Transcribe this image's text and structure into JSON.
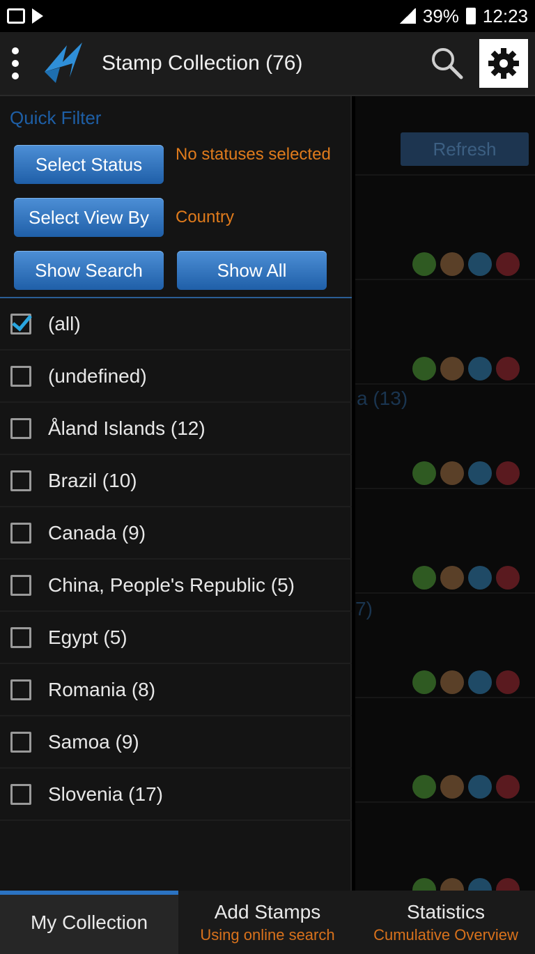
{
  "status_bar": {
    "battery": "39%",
    "time": "12:23"
  },
  "app_bar": {
    "title": "Stamp Collection (76)"
  },
  "background": {
    "refresh_label": "Refresh",
    "ghost_1": "a (13)",
    "ghost_2": "7)"
  },
  "drawer": {
    "quick_filter_title": "Quick Filter",
    "select_status_label": "Select Status",
    "status_note": "No statuses selected",
    "select_view_label": "Select View By",
    "view_note": "Country",
    "show_search_label": "Show Search",
    "show_all_label": "Show All",
    "items": [
      {
        "label": "(all)",
        "checked": true
      },
      {
        "label": "(undefined)",
        "checked": false
      },
      {
        "label": "Åland Islands (12)",
        "checked": false
      },
      {
        "label": "Brazil (10)",
        "checked": false
      },
      {
        "label": "Canada (9)",
        "checked": false
      },
      {
        "label": "China, People's Republic (5)",
        "checked": false
      },
      {
        "label": "Egypt (5)",
        "checked": false
      },
      {
        "label": "Romania (8)",
        "checked": false
      },
      {
        "label": "Samoa (9)",
        "checked": false
      },
      {
        "label": "Slovenia (17)",
        "checked": false
      }
    ]
  },
  "tabs": [
    {
      "title": "My Collection",
      "sub": ""
    },
    {
      "title": "Add Stamps",
      "sub": "Using online search"
    },
    {
      "title": "Statistics",
      "sub": "Cumulative Overview"
    }
  ],
  "colors": {
    "accent": "#2b73c2",
    "note": "#e07b1c",
    "dot_green": "#2f5a22",
    "dot_brown": "#5a4028",
    "dot_blue": "#1f4a66",
    "dot_red": "#5a1a1f"
  }
}
